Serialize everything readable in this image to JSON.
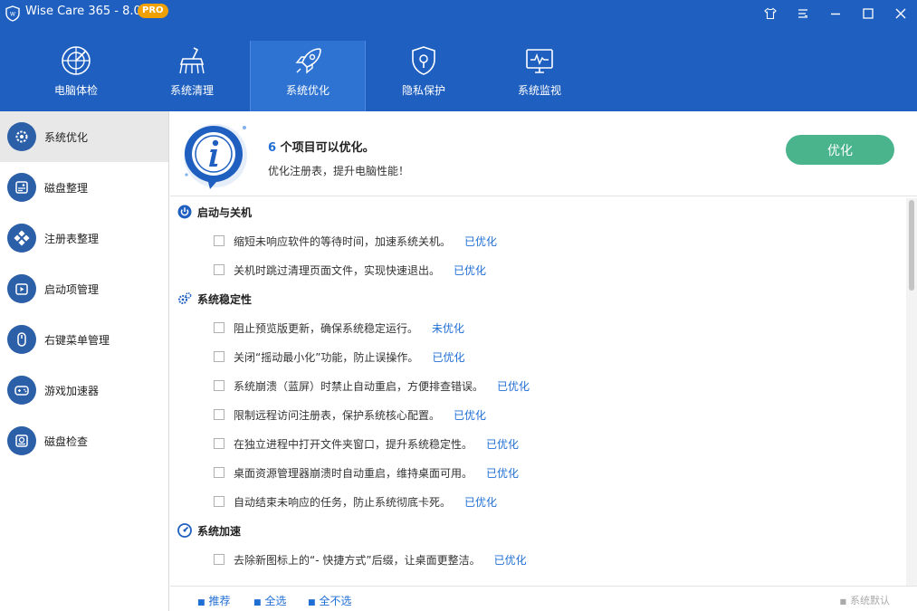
{
  "app": {
    "title": "Wise Care 365 - 8.0.4",
    "badge": "PRO"
  },
  "window_controls": [
    "skin-icon",
    "menu-icon",
    "minimize-icon",
    "maximize-icon",
    "close-icon"
  ],
  "nav": {
    "items": [
      {
        "label": "电脑体检",
        "icon": "radar-icon"
      },
      {
        "label": "系统清理",
        "icon": "brush-icon"
      },
      {
        "label": "系统优化",
        "icon": "rocket-icon",
        "active": true
      },
      {
        "label": "隐私保护",
        "icon": "shield-lock-icon"
      },
      {
        "label": "系统监视",
        "icon": "monitor-icon"
      }
    ]
  },
  "sidebar": {
    "items": [
      {
        "label": "系统优化",
        "icon": "gear-icon",
        "active": true
      },
      {
        "label": "磁盘整理",
        "icon": "disk-defrag-icon"
      },
      {
        "label": "注册表整理",
        "icon": "registry-icon"
      },
      {
        "label": "启动项管理",
        "icon": "startup-icon"
      },
      {
        "label": "右键菜单管理",
        "icon": "mouse-icon"
      },
      {
        "label": "游戏加速器",
        "icon": "gamepad-icon"
      },
      {
        "label": "磁盘检查",
        "icon": "disk-check-icon"
      }
    ]
  },
  "info": {
    "count": "6",
    "count_suffix": "个项目可以优化。",
    "subtitle": "优化注册表，提升电脑性能！",
    "button": "优化"
  },
  "sections": [
    {
      "title": "启动与关机",
      "icon": "power-icon",
      "items": [
        {
          "text": "缩短未响应软件的等待时间，加速系统关机。",
          "status": "已优化"
        },
        {
          "text": "关机时跳过清理页面文件，实现快速退出。",
          "status": "已优化"
        }
      ]
    },
    {
      "title": "系统稳定性",
      "icon": "gears-icon",
      "items": [
        {
          "text": "阻止预览版更新，确保系统稳定运行。",
          "status": "未优化"
        },
        {
          "text": "关闭“摇动最小化”功能，防止误操作。",
          "status": "已优化"
        },
        {
          "text": "系统崩溃（蓝屏）时禁止自动重启，方便排查错误。",
          "status": "已优化"
        },
        {
          "text": "限制远程访问注册表，保护系统核心配置。",
          "status": "已优化"
        },
        {
          "text": "在独立进程中打开文件夹窗口，提升系统稳定性。",
          "status": "已优化"
        },
        {
          "text": "桌面资源管理器崩溃时自动重启，维持桌面可用。",
          "status": "已优化"
        },
        {
          "text": "自动结束未响应的任务，防止系统彻底卡死。",
          "status": "已优化"
        }
      ]
    },
    {
      "title": "系统加速",
      "icon": "speedometer-icon",
      "items": [
        {
          "text": "去除新图标上的“- 快捷方式”后缀，让桌面更整洁。",
          "status": "已优化"
        }
      ]
    }
  ],
  "footer": {
    "recommend": "推荐",
    "select_all": "全选",
    "select_none": "全不选",
    "default": "系统默认"
  },
  "colors": {
    "header_bg": "#1f5fbf",
    "active_nav": "#2e73d2",
    "accent_blue": "#1f6ed4",
    "optimize_green": "#4ab48d",
    "sidebar_icon": "#2b5fa8"
  }
}
